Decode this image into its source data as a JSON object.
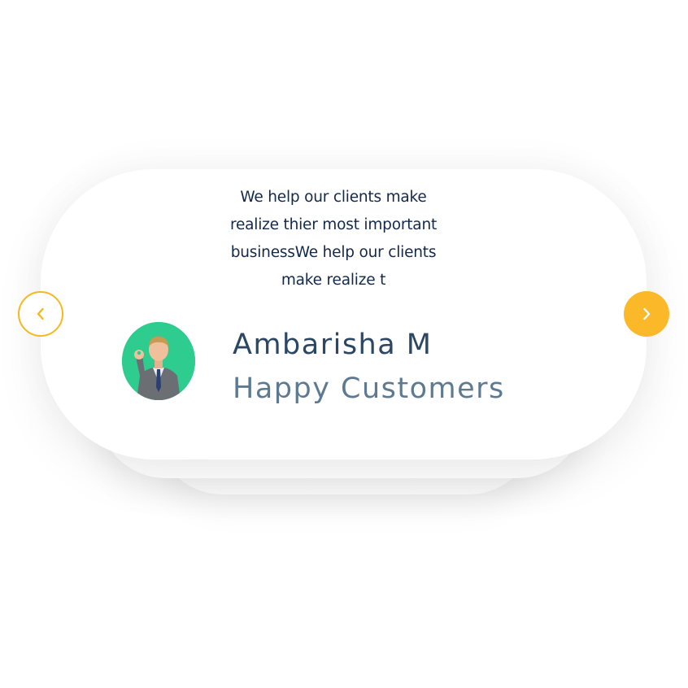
{
  "testimonial": {
    "quote": "We help our clients make\nrealize thier most important\nbusinessWe help our clients\nmake realize t",
    "name": "Ambarisha M",
    "role": "Happy Customers",
    "avatar_bg": "#2ecc8f"
  },
  "navigation": {
    "prev_icon": "chevron-left-icon",
    "next_icon": "chevron-right-icon",
    "accent": "#fbb829"
  },
  "colors": {
    "quote_text": "#13294b",
    "name_text": "#2c4763",
    "role_text": "#5e7a90"
  }
}
